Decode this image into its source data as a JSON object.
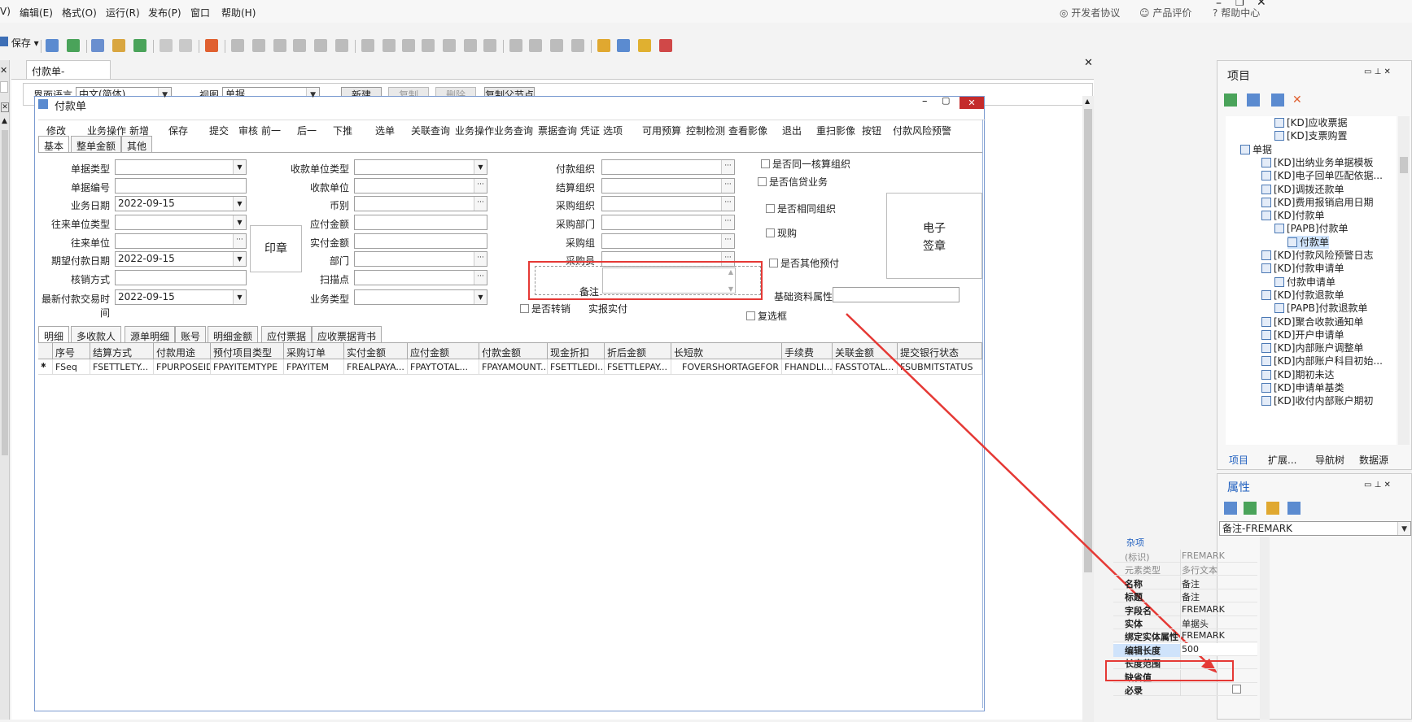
{
  "menu": {
    "items": [
      "V)",
      "编辑(E)",
      "格式(O)",
      "运行(R)",
      "发布(P)",
      "窗口",
      "帮助(H)"
    ],
    "right": [
      "开发者协议",
      "产品评价",
      "帮助中心"
    ]
  },
  "toolbar": {
    "save_label": "保存"
  },
  "doc_tab": "付款单-_Default",
  "ctrl": {
    "lang_label": "界面语言",
    "lang_value": "中文(简体)",
    "view_label": "视图",
    "view_value": "单据",
    "buttons": [
      "新建",
      "复制",
      "删除",
      "复制父节点"
    ]
  },
  "form": {
    "title": "付款单",
    "actions": [
      "修改",
      "业务操作",
      "新增",
      "保存",
      "提交",
      "审核",
      "前一",
      "后一",
      "下推",
      "选单",
      "关联查询",
      "业务操作",
      "业务查询",
      "票据查询",
      "凭证",
      "选项",
      "可用预算",
      "控制检测",
      "查看影像",
      "退出",
      "重扫影像",
      "按钮",
      "付款风险预警"
    ],
    "tabs": [
      "基本",
      "整单金额",
      "其他"
    ],
    "col1": [
      {
        "label": "单据类型",
        "value": ""
      },
      {
        "label": "单据编号",
        "value": ""
      },
      {
        "label": "业务日期",
        "value": "2022-09-15"
      },
      {
        "label": "往来单位类型",
        "value": ""
      },
      {
        "label": "往来单位",
        "value": ""
      },
      {
        "label": "期望付款日期",
        "value": "2022-09-15"
      },
      {
        "label": "核销方式",
        "value": ""
      },
      {
        "label": "最新付款交易时间",
        "value": "2022-09-15"
      }
    ],
    "seal": "印章",
    "col2": [
      "收款单位类型",
      "收款单位",
      "币别",
      "应付金额",
      "实付金额",
      "部门",
      "扫描点",
      "业务类型"
    ],
    "col3": [
      "付款组织",
      "结算组织",
      "采购组织",
      "采购部门",
      "采购组",
      "采购员"
    ],
    "remark_label": "备注",
    "checks": [
      "是否同一核算组织",
      "是否信贷业务",
      "是否相同组织",
      "现购",
      "是否其他预付",
      "是否转销",
      "复选框"
    ],
    "shibao": "实报实付",
    "esign": [
      "电子",
      "签章"
    ],
    "basic_attr": "基础资料属性",
    "grid_tabs": [
      "明细",
      "多收款人",
      "源单明细",
      "账号",
      "明细金额",
      "应付票据",
      "应收票据背书"
    ],
    "grid_headers": [
      "序号",
      "结算方式",
      "付款用途",
      "预付项目类型",
      "采购订单",
      "实付金额",
      "应付金额",
      "付款金额",
      "现金折扣",
      "折后金额",
      "长短款",
      "手续费",
      "关联金额",
      "提交银行状态"
    ],
    "grid_row": [
      "FSeq",
      "FSETTLETY...",
      "FPURPOSEID",
      "FPAYITEMTYPE",
      "FPAYITEM",
      "FREALPAYA...",
      "FPAYTOTAL...",
      "FPAYAMOUNT...",
      "FSETTLEDI...",
      "FSETTLEPAY...",
      "FOVERSHORTAGEFOR",
      "FHANDLI...",
      "FASSTOTAL...",
      "FSUBMITSTATUS"
    ]
  },
  "project": {
    "title": "项目",
    "tree": [
      "[KD]应收票据",
      "[KD]支票购置",
      "单据",
      "[KD]出纳业务单据模板",
      "[KD]电子回单匹配依据...",
      "[KD]调拨还款单",
      "[KD]费用报销启用日期",
      "[KD]付款单",
      "[PAPB]付款单",
      "付款单",
      "[KD]付款风险预警日志",
      "[KD]付款申请单",
      "付款申请单",
      "[KD]付款退款单",
      "[PAPB]付款退款单",
      "[KD]聚合收款通知单",
      "[KD]开户申请单",
      "[KD]内部账户调整单",
      "[KD]内部账户科目初始...",
      "[KD]期初未达",
      "[KD]申请单基类",
      "[KD]收付内部账户期初"
    ],
    "tabs": [
      "项目",
      "扩展...",
      "导航树",
      "数据源"
    ]
  },
  "props": {
    "title": "属性",
    "selector": "备注-FREMARK",
    "category": "杂项",
    "rows": [
      {
        "k": "(标识)",
        "v": "FREMARK",
        "dim": true
      },
      {
        "k": "元素类型",
        "v": "多行文本",
        "dim": true
      },
      {
        "k": "名称",
        "v": "备注"
      },
      {
        "k": "标题",
        "v": "备注"
      },
      {
        "k": "字段名",
        "v": "FREMARK"
      },
      {
        "k": "实体",
        "v": "单据头"
      },
      {
        "k": "绑定实体属性",
        "v": "FREMARK"
      },
      {
        "k": "编辑长度",
        "v": "500"
      },
      {
        "k": "长度范围",
        "v": ""
      },
      {
        "k": "缺省值",
        "v": ""
      },
      {
        "k": "必录",
        "v": ""
      }
    ]
  }
}
